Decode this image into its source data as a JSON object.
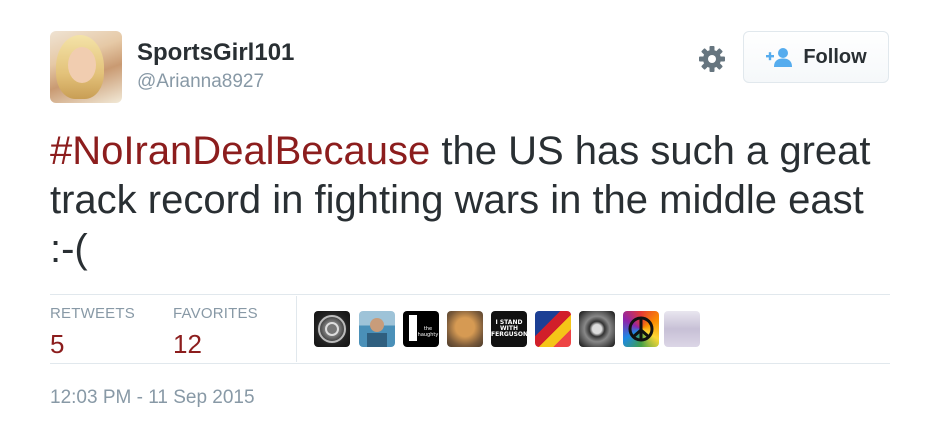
{
  "user": {
    "name": "SportsGirl101",
    "handle": "@Arianna8927"
  },
  "header": {
    "follow_label": "Follow",
    "settings_icon": "gear-icon",
    "follow_icon": "add-user-icon"
  },
  "tweet": {
    "hashtag": "#NoIranDealBecause",
    "text": " the US has such a great track record in fighting wars in the middle east :-("
  },
  "stats": {
    "retweets_label": "RETWEETS",
    "retweets_count": "5",
    "favorites_label": "FAVORITES",
    "favorites_count": "12"
  },
  "favoriters": {
    "avatar_3_text": "the haughty",
    "avatar_5_text": "I STAND WITH FERGUSON"
  },
  "timestamp": "12:03 PM - 11 Sep 2015",
  "colors": {
    "hashtag": "#8c1d1d",
    "count": "#8c1d1d",
    "muted": "#8899a6",
    "text": "#292f33",
    "follow_icon": "#55acee"
  }
}
